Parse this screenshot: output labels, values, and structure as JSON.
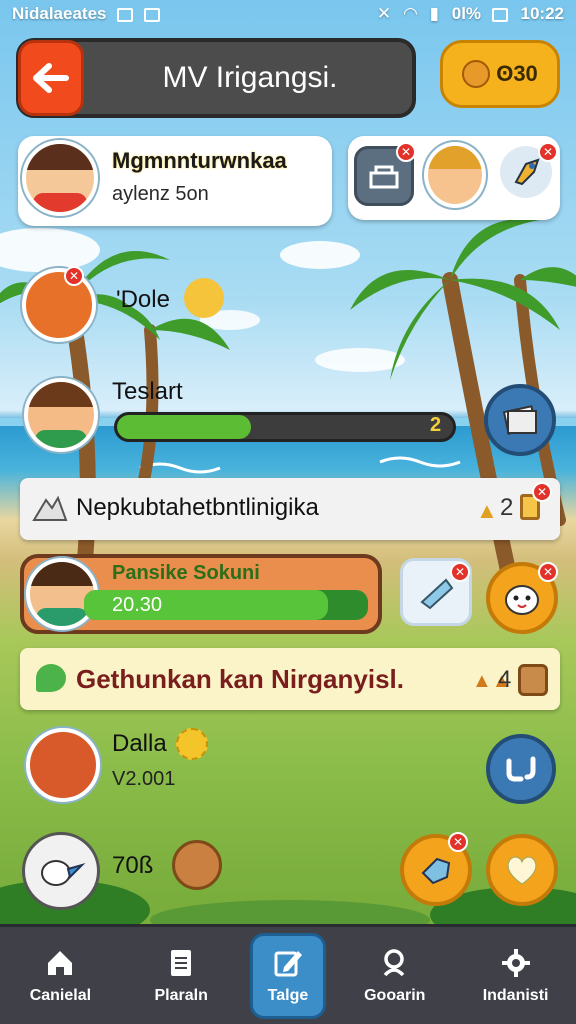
{
  "status_bar": {
    "app_label": "Nidalaeates",
    "battery": "0l%",
    "time": "10:22"
  },
  "header": {
    "title": "MV Irigangsi.",
    "coins": "ʘ30"
  },
  "profile": {
    "name": "Mgmnnturwnkaa",
    "subtitle": "aylenz 5on"
  },
  "players": [
    {
      "name": "'Dole"
    },
    {
      "name": "Teslart",
      "progress_label": "2",
      "progress_fraction": 0.4
    },
    {
      "name": "Dalla",
      "value": "V2.001"
    },
    {
      "name": "",
      "value": "70ß"
    }
  ],
  "banner1": {
    "text": "Nepkubtahetbntlinigika",
    "count": "2"
  },
  "task_card": {
    "title": "Pansike Sokuni",
    "value": "20.30",
    "progress_fraction": 0.86
  },
  "banner2": {
    "text": "Gethunkan kan Nirganyisl.",
    "count": "4"
  },
  "nav": {
    "items": [
      {
        "label": "Canielal",
        "icon": "home-icon"
      },
      {
        "label": "Plaraln",
        "icon": "document-icon"
      },
      {
        "label": "Talge",
        "icon": "edit-icon"
      },
      {
        "label": "Gooarin",
        "icon": "search-icon"
      },
      {
        "label": "Indanisti",
        "icon": "gear-icon"
      }
    ]
  },
  "colors": {
    "accent": "#f04a1d",
    "coin": "#f5b21c",
    "nav_bg": "#3f4048",
    "nav_active": "#3c8ec9",
    "progress_green": "#5cbd34"
  }
}
